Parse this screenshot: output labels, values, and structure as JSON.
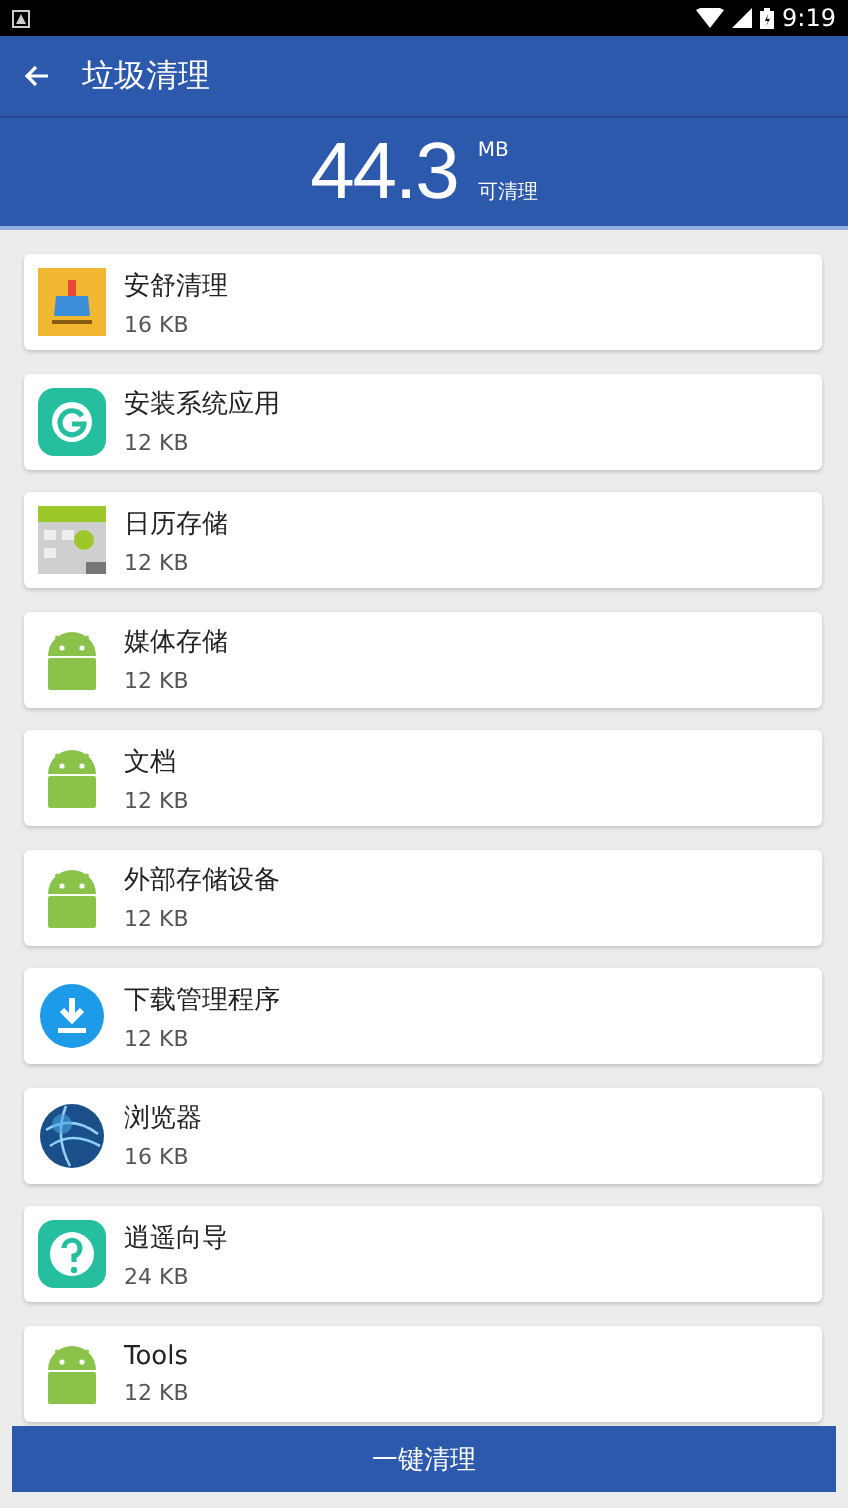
{
  "status_bar": {
    "time": "9:19"
  },
  "app_bar": {
    "title": "垃圾清理"
  },
  "summary": {
    "amount": "44.3",
    "unit": "MB",
    "caption": "可清理"
  },
  "items": [
    {
      "name": "安舒清理",
      "size": "16 KB",
      "kind": "broom"
    },
    {
      "name": "安装系统应用",
      "size": "12 KB",
      "kind": "g"
    },
    {
      "name": "日历存储",
      "size": "12 KB",
      "kind": "calendar"
    },
    {
      "name": "媒体存储",
      "size": "12 KB",
      "kind": "android"
    },
    {
      "name": "文档",
      "size": "12 KB",
      "kind": "android"
    },
    {
      "name": "外部存储设备",
      "size": "12 KB",
      "kind": "android"
    },
    {
      "name": "下载管理程序",
      "size": "12 KB",
      "kind": "download"
    },
    {
      "name": "浏览器",
      "size": "16 KB",
      "kind": "globe"
    },
    {
      "name": "逍遥向导",
      "size": "24 KB",
      "kind": "help"
    },
    {
      "name": "Tools",
      "size": "12 KB",
      "kind": "android"
    }
  ],
  "clean_button": {
    "label": "一键清理"
  }
}
